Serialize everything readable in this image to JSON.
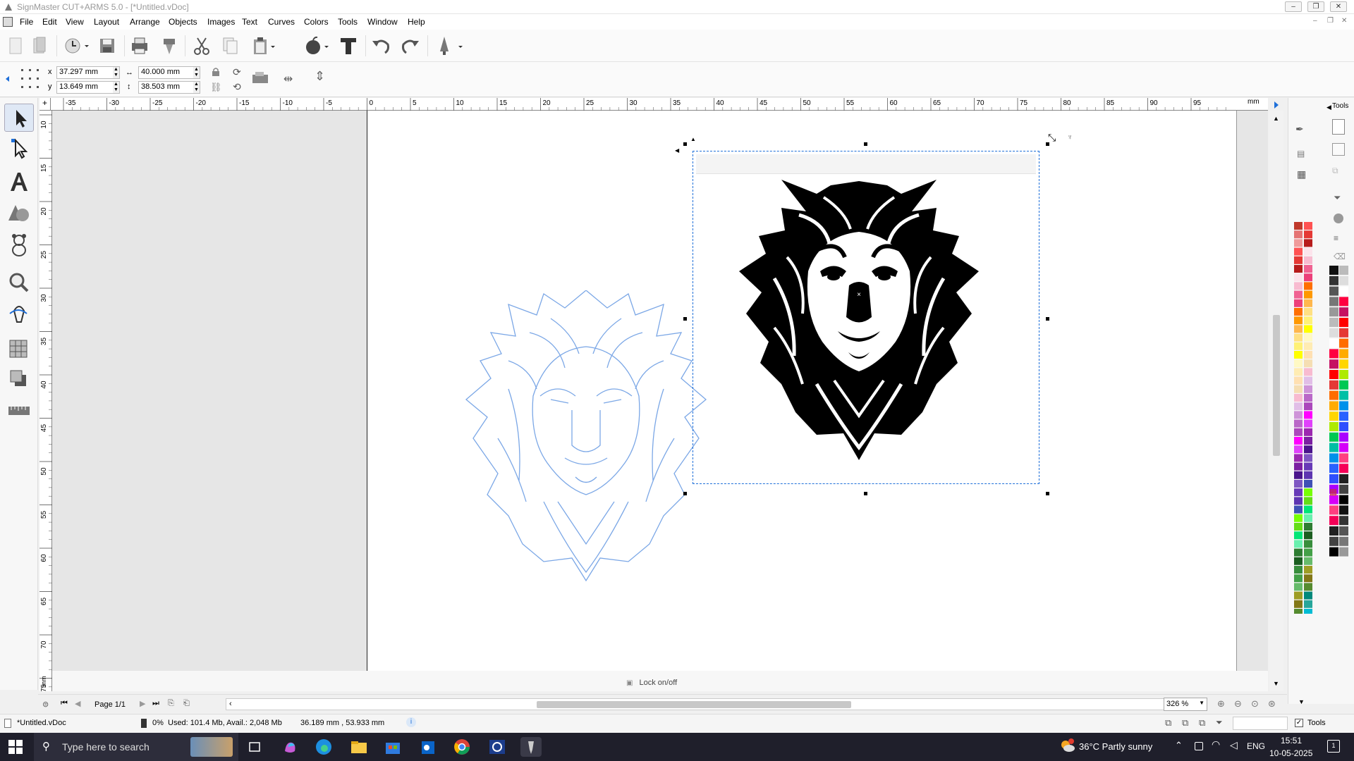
{
  "window": {
    "title": "SignMaster CUT+ARMS 5.0 - [*Untitled.vDoc]"
  },
  "menu": [
    "File",
    "Edit",
    "View",
    "Layout",
    "Arrange",
    "Objects",
    "Images",
    "Text",
    "Curves",
    "Colors",
    "Tools",
    "Window",
    "Help"
  ],
  "props": {
    "x_label": "x",
    "y_label": "y",
    "x_value": "37.297 mm",
    "y_value": "13.649 mm",
    "w_value": "40.000 mm",
    "h_value": "38.503 mm"
  },
  "ruler": {
    "unit": "mm",
    "h_ticks": [
      "-35",
      "-30",
      "-25",
      "-20",
      "-15",
      "-10",
      "-5",
      "0",
      "5",
      "10",
      "15",
      "20",
      "25",
      "30",
      "35",
      "40",
      "45",
      "50",
      "55",
      "60",
      "65",
      "70",
      "75",
      "80",
      "85",
      "90",
      "95"
    ],
    "v_ticks": [
      "10",
      "15",
      "20",
      "25",
      "30",
      "35",
      "40",
      "45",
      "50",
      "55",
      "60",
      "65",
      "70",
      "75"
    ],
    "v_unit": "mm"
  },
  "canvas": {
    "lock_label": "Lock on/off"
  },
  "right_panel": {
    "tools_label": "Tools"
  },
  "pagebar": {
    "page_label": "Page 1/1",
    "zoom": "326 %"
  },
  "status": {
    "doc": "*Untitled.vDoc",
    "progress": "0%",
    "memory": "Used: 101.4 Mb, Avail.: 2,048 Mb",
    "coords": "36.189 mm , 53.933 mm",
    "tools_check": "Tools"
  },
  "taskbar": {
    "search_placeholder": "Type here to search",
    "weather": "36°C  Partly sunny",
    "lang": "ENG",
    "time": "15:51",
    "date": "10-05-2025"
  },
  "colors": {
    "accent": "#1e6fd9",
    "trace_outline": "#7ba7e6",
    "taskbar": "#1f1f2b"
  }
}
